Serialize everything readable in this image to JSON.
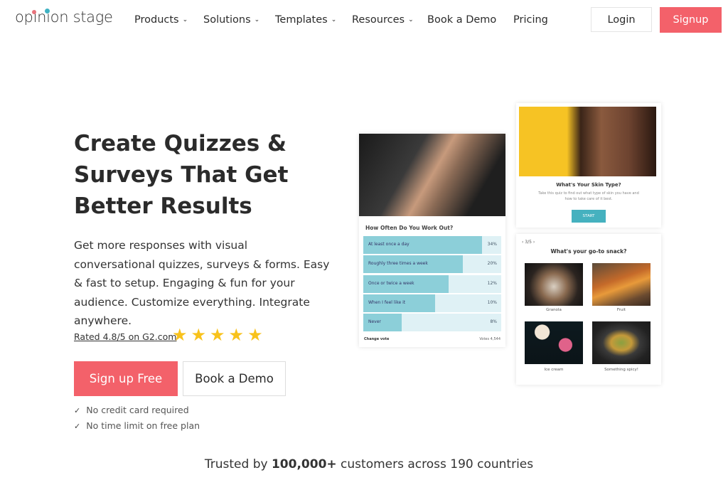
{
  "nav": {
    "logo": "opinion stage",
    "logo_dot_colors": [
      "#e8737c",
      "#3fb1c2"
    ],
    "items": [
      {
        "label": "Products",
        "has_dropdown": true
      },
      {
        "label": "Solutions",
        "has_dropdown": true
      },
      {
        "label": "Templates",
        "has_dropdown": true
      },
      {
        "label": "Resources",
        "has_dropdown": true
      },
      {
        "label": "Book a Demo",
        "has_dropdown": false
      },
      {
        "label": "Pricing",
        "has_dropdown": false
      }
    ],
    "login_label": "Login",
    "signup_label": "Signup",
    "chevron_glyph": "⌄"
  },
  "hero": {
    "title": "Create Quizzes & Surveys That Get Better Results",
    "subtitle": "Get more responses with visual conversational quizzes, surveys & forms. Easy & fast to setup. Engaging & fun for your audience. Customize everything. Integrate anywhere.",
    "rating_text": "Rated 4.8/5 on G2.com",
    "rating_value": 4.8,
    "rating_max": 5,
    "stars_glyph": "★★★★★",
    "primary_cta": "Sign up Free",
    "secondary_cta": "Book a Demo",
    "checks": [
      "No credit card required",
      "No time limit on free plan"
    ],
    "check_glyph": "✓"
  },
  "poll_card": {
    "question": "How Often Do You Work Out?",
    "options": [
      {
        "label": "At least once a day",
        "percent": "34%",
        "fill": 0.86
      },
      {
        "label": "Roughly three times a week",
        "percent": "20%",
        "fill": 0.72
      },
      {
        "label": "Once or twice a week",
        "percent": "12%",
        "fill": 0.62
      },
      {
        "label": "When I feel like it",
        "percent": "10%",
        "fill": 0.52
      },
      {
        "label": "Never",
        "percent": "8%",
        "fill": 0.28
      }
    ],
    "change_vote": "Change vote",
    "votes": "Votes 4,544"
  },
  "skin_card": {
    "title": "What's Your Skin Type?",
    "description": "Take this quiz to find out what type of skin you have and how to take care of it best.",
    "start_label": "START"
  },
  "snack_card": {
    "pager": "‹ 3/5 ›",
    "title": "What's your go-to snack?",
    "options": [
      "Granola",
      "Fruit",
      "Ice cream",
      "Something spicy!"
    ]
  },
  "footer": {
    "trusted_prefix": "Trusted by ",
    "trusted_bold": "100,000+",
    "trusted_suffix": " customers across 190 countries"
  },
  "colors": {
    "accent": "#f3616a",
    "poll_fill": "#8ccfd9",
    "poll_track": "#dff1f5",
    "star": "#f8c21c",
    "start_button": "#45b1bf"
  }
}
